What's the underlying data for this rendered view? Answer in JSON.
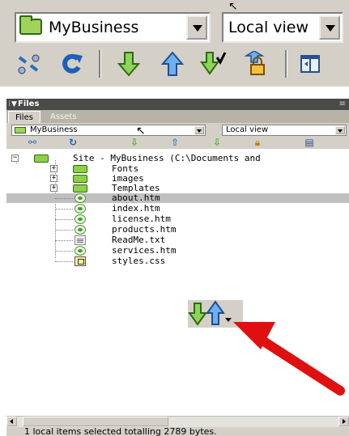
{
  "top_toolbar": {
    "site_select_value": "MyBusiness",
    "view_select_value": "Local view",
    "tools": [
      "connect-icon",
      "refresh-icon",
      "get-files-icon",
      "put-files-icon",
      "check-out-icon",
      "check-in-icon",
      "expand-icon"
    ]
  },
  "files_panel": {
    "title": "Files",
    "options_glyph": "≡",
    "tabs": [
      "Files",
      "Assets"
    ],
    "site_select_value": "MyBusiness",
    "view_select_value": "Local view",
    "tree": {
      "root_label": "Site - MyBusiness (C:\\Documents and",
      "folders": [
        "Fonts",
        "images",
        "Templates"
      ],
      "files": [
        {
          "name": "about.htm",
          "type": "htm",
          "selected": true
        },
        {
          "name": "index.htm",
          "type": "htm",
          "selected": false
        },
        {
          "name": "license.htm",
          "type": "htm",
          "selected": false
        },
        {
          "name": "products.htm",
          "type": "htm",
          "selected": false
        },
        {
          "name": "ReadMe.txt",
          "type": "txt",
          "selected": false
        },
        {
          "name": "services.htm",
          "type": "htm",
          "selected": false
        },
        {
          "name": "styles.css",
          "type": "css",
          "selected": false
        }
      ]
    }
  },
  "status_bar": {
    "text": "1 local items selected totalling 2789 bytes."
  },
  "colors": {
    "panel_bg": "#d4d0c8",
    "title_bar": "#4a4a4a",
    "get_green": "#4caf2a",
    "put_blue": "#2a7fd6",
    "callout_red": "#e01010"
  }
}
